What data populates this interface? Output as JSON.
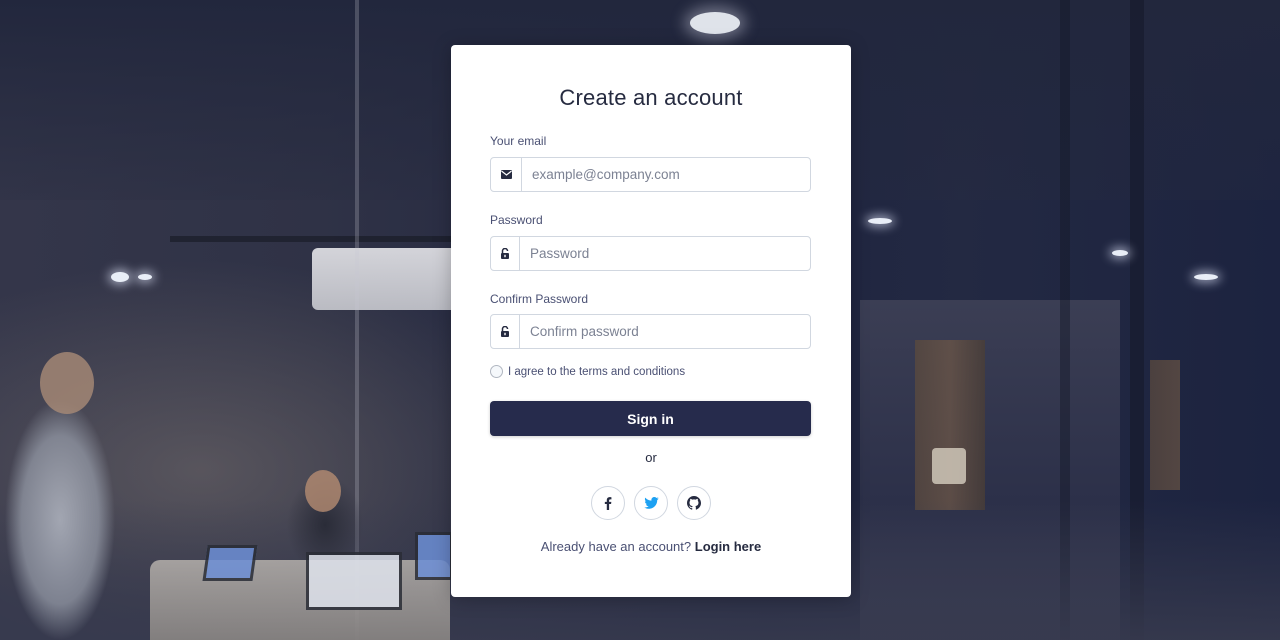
{
  "form": {
    "title": "Create an account",
    "email": {
      "label": "Your email",
      "placeholder": "example@company.com",
      "value": "",
      "icon": "envelope-icon"
    },
    "password": {
      "label": "Password",
      "placeholder": "Password",
      "value": "",
      "icon": "unlock-icon"
    },
    "confirm_password": {
      "label": "Confirm Password",
      "placeholder": "Confirm password",
      "value": "",
      "icon": "unlock-icon"
    },
    "terms": {
      "label": "I agree to the terms and conditions",
      "checked": false
    },
    "submit_label": "Sign in",
    "divider_text": "or",
    "social": [
      {
        "icon": "facebook-icon",
        "color": "#262b40"
      },
      {
        "icon": "twitter-icon",
        "color": "#1da1f2"
      },
      {
        "icon": "github-icon",
        "color": "#262b40"
      }
    ],
    "footer": {
      "prompt": "Already have an account?",
      "link": "Login here"
    }
  },
  "colors": {
    "primary": "#262b4c",
    "text": "#262b40",
    "border": "#d1d7e0",
    "card_bg": "#ffffff",
    "twitter": "#1da1f2"
  }
}
